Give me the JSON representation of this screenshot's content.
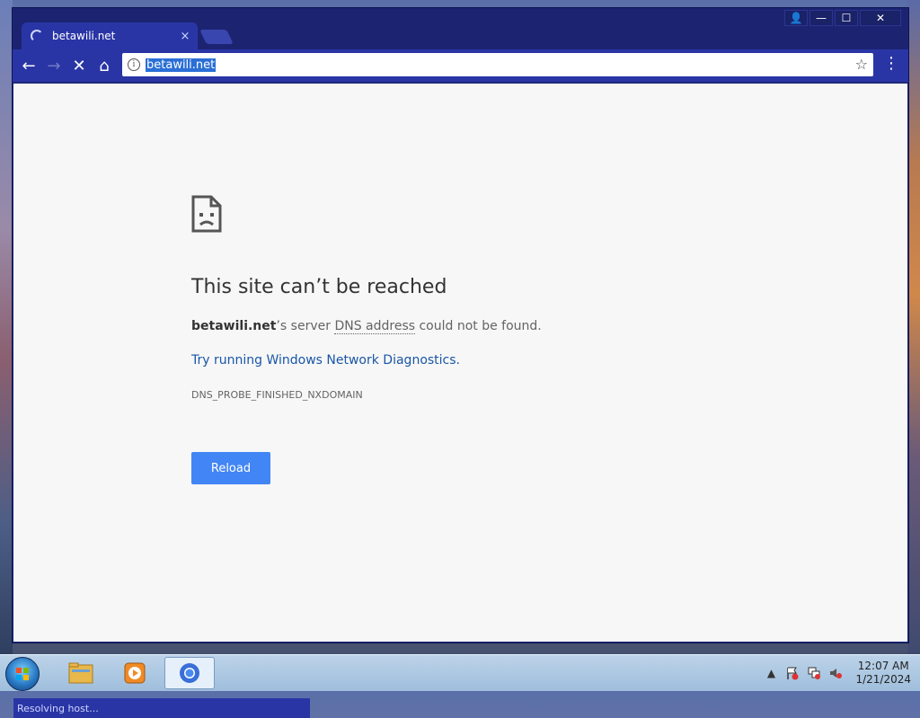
{
  "window": {
    "tab": {
      "title": "betawili.net",
      "close": "×"
    },
    "controls": {
      "user": "👤",
      "minimize": "—",
      "maximize": "☐",
      "close": "✕"
    }
  },
  "toolbar": {
    "back": "←",
    "forward": "→",
    "stop": "✕",
    "home": "⌂",
    "url": "betawili.net",
    "info": "i",
    "bookmark": "☆",
    "menu": "⋮"
  },
  "error": {
    "title": "This site can’t be reached",
    "site": "betawili.net",
    "desc_mid": "’s server ",
    "desc_abbr": "DNS address",
    "desc_end": " could not be found.",
    "link": "Try running Windows Network Diagnostics.",
    "code": "DNS_PROBE_FINISHED_NXDOMAIN",
    "reload": "Reload"
  },
  "status": "Resolving host...",
  "taskbar": {
    "clock_time": "12:07 AM",
    "clock_date": "1/21/2024",
    "tray_up": "▲"
  },
  "colors": {
    "frame": "#1c2472",
    "toolbar": "#2a35a5",
    "reload_button": "#4285f4",
    "link": "#1a56a6"
  }
}
